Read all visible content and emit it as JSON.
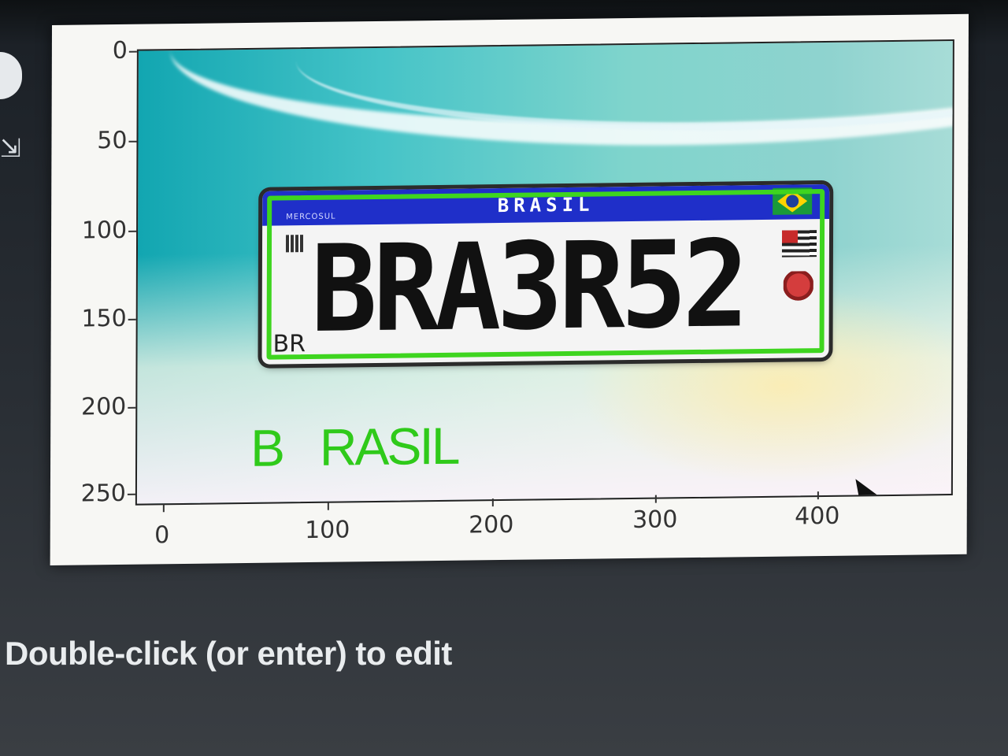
{
  "toolbar": {
    "run_icon": "run-cell-icon",
    "expand_icon": "expand-output-icon"
  },
  "plot": {
    "y_ticks": [
      "0",
      "50",
      "100",
      "150",
      "200",
      "250"
    ],
    "x_ticks": [
      "0",
      "100",
      "200",
      "300",
      "400"
    ],
    "image_content": {
      "plate_header": "BRASIL",
      "plate_header_small": "MERCOSUL",
      "plate_number": "BRA3R52",
      "plate_country_code": "BR"
    },
    "detection_box_color": "#3ed51f",
    "overlay_text": "B  RASIL",
    "overlay_text_color": "#2fca1a"
  },
  "cell": {
    "edit_hint": "Double-click (or enter) to edit"
  }
}
